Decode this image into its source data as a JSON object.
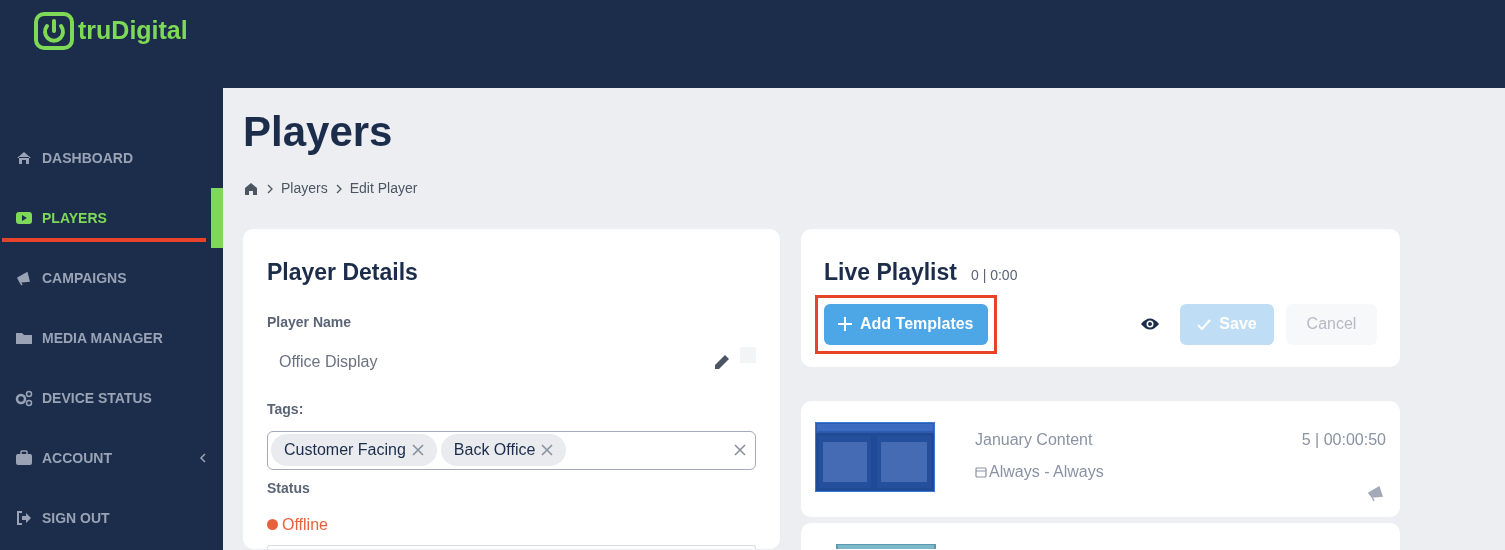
{
  "brand": {
    "name": "truDigital"
  },
  "sidebar": {
    "items": [
      {
        "label": "DASHBOARD",
        "selected": false,
        "annotated": false,
        "expandable": false
      },
      {
        "label": "PLAYERS",
        "selected": true,
        "annotated": true,
        "expandable": false
      },
      {
        "label": "CAMPAIGNS",
        "selected": false,
        "annotated": false,
        "expandable": false
      },
      {
        "label": "MEDIA MANAGER",
        "selected": false,
        "annotated": false,
        "expandable": false
      },
      {
        "label": "DEVICE STATUS",
        "selected": false,
        "annotated": false,
        "expandable": false
      },
      {
        "label": "ACCOUNT",
        "selected": false,
        "annotated": false,
        "expandable": true
      },
      {
        "label": "SIGN OUT",
        "selected": false,
        "annotated": false,
        "expandable": false
      }
    ]
  },
  "page": {
    "title": "Players",
    "breadcrumb": [
      "Players",
      "Edit Player"
    ]
  },
  "player_details": {
    "title": "Player Details",
    "name_label": "Player Name",
    "name_value": "Office Display",
    "checked": false,
    "tags_label": "Tags:",
    "tags": [
      "Customer Facing",
      "Back Office"
    ],
    "status_label": "Status",
    "status": "Offline",
    "online": false
  },
  "live_playlist": {
    "title": "Live Playlist",
    "summary": "0 | 0:00",
    "add_button": {
      "label": "Add Templates",
      "annotated": true
    },
    "save_button": {
      "label": "Save",
      "disabled": true
    },
    "cancel_button": {
      "label": "Cancel",
      "disabled": true
    }
  },
  "playlist_items": [
    {
      "name": "January Content",
      "schedule": "Always - Always",
      "duration": "5 | 00:00:50"
    }
  ]
}
